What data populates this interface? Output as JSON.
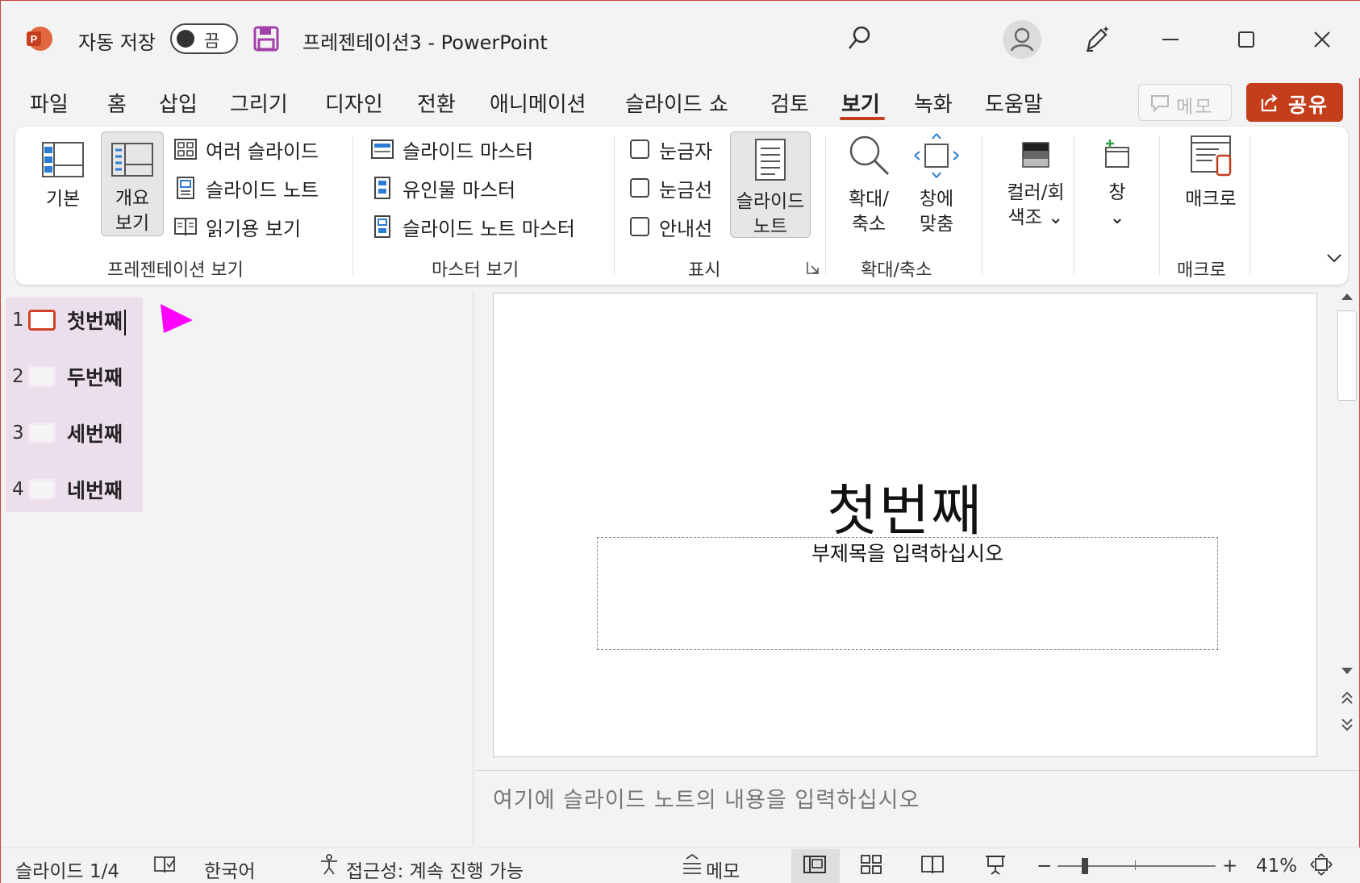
{
  "titlebar": {
    "autosave_label": "자동 저장",
    "autosave_state": "끔",
    "document_title": "프레젠테이션3  -  PowerPoint"
  },
  "tabs": [
    {
      "label": "파일"
    },
    {
      "label": "홈"
    },
    {
      "label": "삽입"
    },
    {
      "label": "그리기"
    },
    {
      "label": "디자인"
    },
    {
      "label": "전환"
    },
    {
      "label": "애니메이션"
    },
    {
      "label": "슬라이드 쇼"
    },
    {
      "label": "검토"
    },
    {
      "label": "보기"
    },
    {
      "label": "녹화"
    },
    {
      "label": "도움말"
    }
  ],
  "active_tab": "보기",
  "header_buttons": {
    "memo": "메모",
    "share": "공유"
  },
  "ribbon": {
    "presentation_views": {
      "label": "프레젠테이션 보기",
      "normal": "기본",
      "outline_line1": "개요",
      "outline_line2": "보기",
      "slide_sorter": "여러 슬라이드",
      "notes_page": "슬라이드 노트",
      "reading_view": "읽기용 보기"
    },
    "master_views": {
      "label": "마스터 보기",
      "slide_master": "슬라이드 마스터",
      "handout_master": "유인물 마스터",
      "notes_master": "슬라이드 노트 마스터"
    },
    "show": {
      "label": "표시",
      "ruler": "눈금자",
      "gridlines": "눈금선",
      "guides": "안내선",
      "notes_line1": "슬라이드",
      "notes_line2": "노트"
    },
    "zoom": {
      "label": "확대/축소",
      "zoom_line1": "확대/",
      "zoom_line2": "축소",
      "fit_line1": "창에",
      "fit_line2": "맞춤"
    },
    "color": {
      "line1": "컬러/회",
      "line2": "색조 ⌄"
    },
    "window": {
      "line1": "창",
      "line2": "⌄"
    },
    "macros": {
      "label": "매크로",
      "button": "매크로"
    }
  },
  "outline": {
    "items": [
      {
        "num": "1",
        "text": "첫번째"
      },
      {
        "num": "2",
        "text": "두번째"
      },
      {
        "num": "3",
        "text": "세번째"
      },
      {
        "num": "4",
        "text": "네번째"
      }
    ]
  },
  "slide": {
    "title": "첫번째",
    "subtitle_placeholder": "부제목을 입력하십시오"
  },
  "notes": {
    "placeholder": "여기에 슬라이드 노트의 내용을 입력하십시오"
  },
  "statusbar": {
    "slide_counter": "슬라이드 1/4",
    "language": "한국어",
    "accessibility": "접근성: 계속 진행 가능",
    "notes": "메모",
    "zoom_minus": "−",
    "zoom_plus": "+",
    "zoom_level": "41%",
    "zoom_fraction": 0.41
  },
  "colors": {
    "accent": "#c43e1c",
    "outline_highlight": "#ecdfec",
    "pointer": "#ff00ff"
  }
}
